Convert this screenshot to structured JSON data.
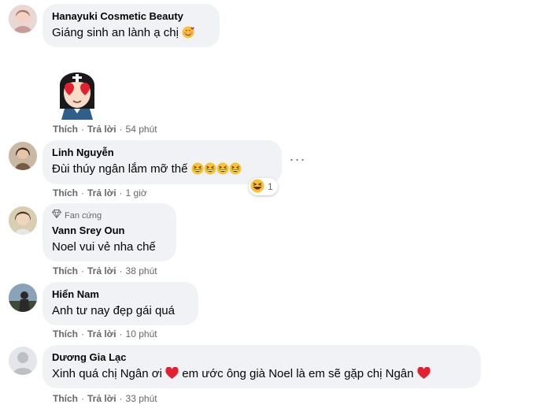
{
  "actions": {
    "like": "Thích",
    "reply": "Trả lời"
  },
  "comments": [
    {
      "name": "Hanayuki Cosmetic Beauty",
      "text": "Giáng sinh an lành ạ chị",
      "time": "54 phút"
    },
    {
      "name": "Linh Nguyễn",
      "text": "Đùi thúy ngân lắm mỡ thế",
      "time": "1 giờ",
      "reaction_count": "1"
    },
    {
      "badge": "Fan cứng",
      "name": "Vann Srey Oun",
      "text": "Noel vui vẻ nha chế",
      "time": "38 phút"
    },
    {
      "name": "Hiển Nam",
      "text": "Anh tư nay đẹp gái quá",
      "time": "10 phút"
    },
    {
      "name": "Dương Gia Lạc",
      "text_a": "Xinh quá chị Ngân ơi",
      "text_b": "em ước ông già Noel là em sẽ gặp chị Ngân",
      "time": "33 phút"
    }
  ],
  "icons": {
    "smiling_hearts": "smiling-face-with-hearts-icon",
    "grin": "grinning-squinting-face-icon",
    "haha": "haha-reaction-icon",
    "heart": "red-heart-icon",
    "diamond": "diamond-badge-icon",
    "more": "more-options-icon"
  },
  "colors": {
    "bubble": "#f0f2f5",
    "secondary_text": "#65676b",
    "heart": "#e4202e"
  }
}
